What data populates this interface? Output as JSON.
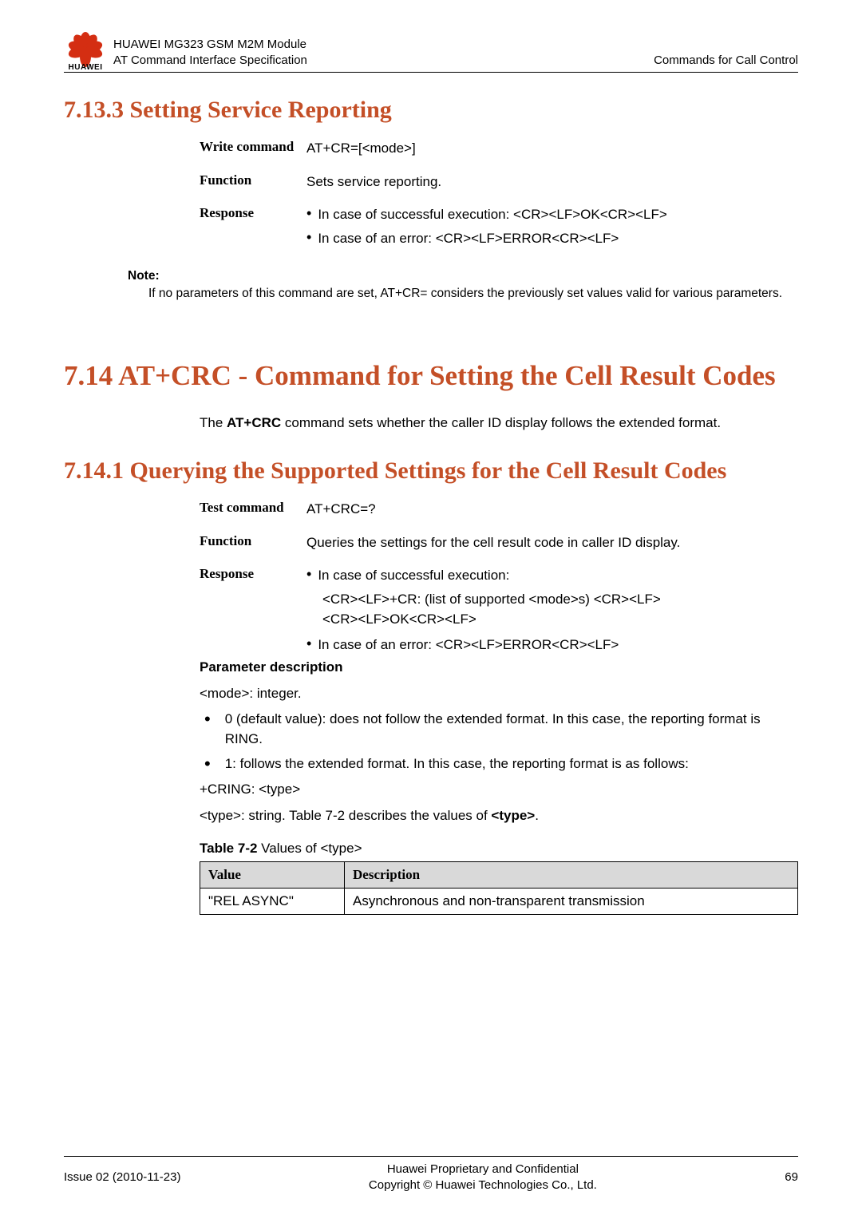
{
  "header": {
    "wordmark": "HUAWEI",
    "line1": "HUAWEI MG323 GSM M2M Module",
    "line2": "AT Command Interface Specification",
    "right": "Commands for Call Control"
  },
  "sec7133": {
    "title": "7.13.3 Setting Service Reporting",
    "rows": {
      "write_label": "Write command",
      "write_value": "AT+CR=[<mode>]",
      "function_label": "Function",
      "function_value": "Sets service reporting.",
      "response_label": "Response",
      "response_b1": "In case of successful execution: <CR><LF>OK<CR><LF>",
      "response_b2": "In case of an error: <CR><LF>ERROR<CR><LF>"
    },
    "note_title": "Note:",
    "note_body": "If no parameters of this command are set, AT+CR= considers the previously set values valid for various parameters."
  },
  "sec714": {
    "title": "7.14 AT+CRC - Command for Setting the Cell Result Codes",
    "intro_pre": "The ",
    "intro_bold": "AT+CRC",
    "intro_post": " command sets whether the caller ID display follows the extended format."
  },
  "sec7141": {
    "title": "7.14.1 Querying the Supported Settings for the Cell Result Codes",
    "rows": {
      "test_label": "Test command",
      "test_value": "AT+CRC=?",
      "function_label": "Function",
      "function_value": "Queries the settings for the cell result code in caller ID display.",
      "response_label": "Response",
      "response_b1": "In case of successful execution:",
      "response_b1_l2": "<CR><LF>+CR: (list of supported <mode>s) <CR><LF>",
      "response_b1_l3": "<CR><LF>OK<CR><LF>",
      "response_b2": "In case of an error: <CR><LF>ERROR<CR><LF>"
    },
    "param_title": "Parameter description",
    "mode_line": "<mode>: integer.",
    "li0": "0 (default value): does not follow the extended format. In this case, the reporting format is RING.",
    "li1": "1: follows the extended format. In this case, the reporting format is as follows:",
    "cring": "+CRING: <type>",
    "type_line_pre": "<type>: string. Table 7-2 describes the values of ",
    "type_line_bold": "<type>",
    "type_line_post": ".",
    "table_caption_bold": "Table 7-2",
    "table_caption_rest": " Values of <type>",
    "th_value": "Value",
    "th_desc": "Description",
    "row1_v": "\"REL ASYNC\"",
    "row1_d": "Asynchronous and non-transparent transmission"
  },
  "footer": {
    "left": "Issue 02 (2010-11-23)",
    "center1": "Huawei Proprietary and Confidential",
    "center2": "Copyright © Huawei Technologies Co., Ltd.",
    "right": "69"
  }
}
